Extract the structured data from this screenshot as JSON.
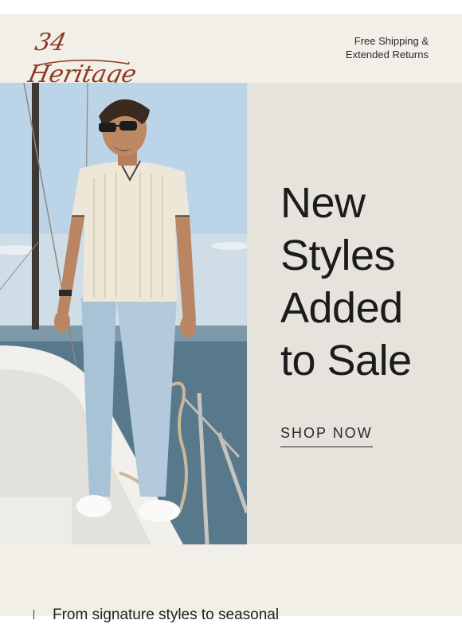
{
  "header": {
    "logo_text": "34 Heritage",
    "shipping_line1": "Free Shipping &",
    "shipping_line2": "Extended Returns"
  },
  "hero": {
    "headline": [
      "New",
      "Styles",
      "Added",
      "to Sale"
    ],
    "cta_label": "SHOP NOW",
    "photo_icon": "model-on-sailboat-photo"
  },
  "body": {
    "intro_text": "From signature styles to seasonal"
  },
  "colors": {
    "header_bg": "#f2eee8",
    "panel_bg": "#e6e2dc",
    "logo": "#8b3a22",
    "text": "#1b1b1b"
  }
}
